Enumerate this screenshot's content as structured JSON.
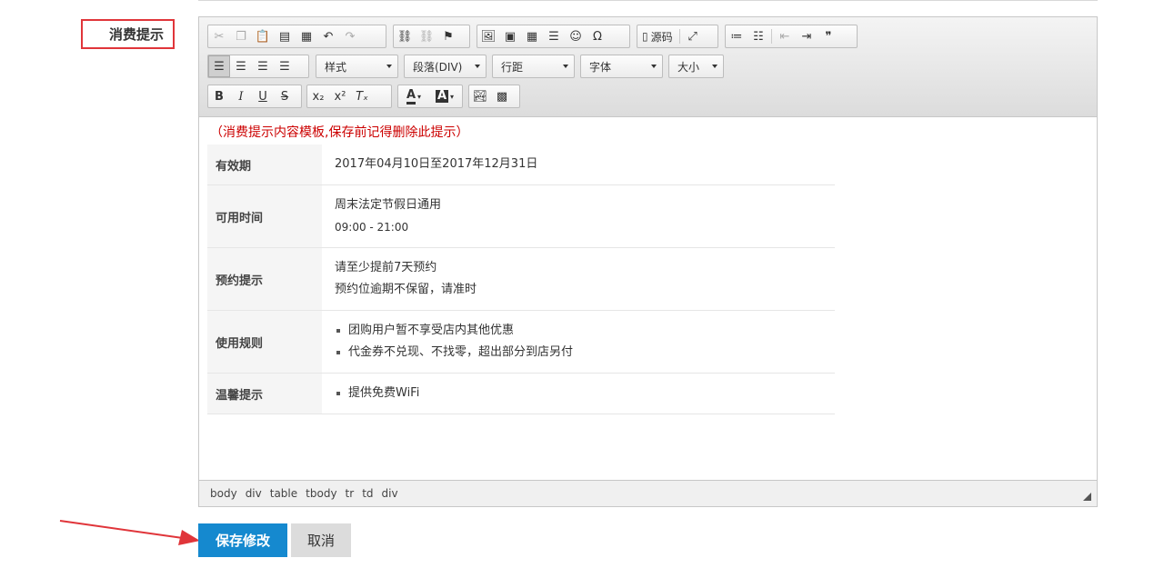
{
  "form": {
    "field_label": "消费提示",
    "save_label": "保存修改",
    "cancel_label": "取消"
  },
  "toolbar": {
    "source_label": "源码",
    "style_select": "样式",
    "paragraph_select": "段落(DIV)",
    "line_height_select": "行距",
    "font_select": "字体",
    "size_select": "大小",
    "omega": "Ω",
    "bold": "B",
    "italic": "I",
    "underline": "U",
    "strike": "S",
    "font_color": "A",
    "bg_color": "A",
    "quote": "❞"
  },
  "content": {
    "notice": "（消费提示内容模板,保存前记得删除此提示）",
    "rows": [
      {
        "key": "有效期",
        "lines": [
          "2017年04月10日至2017年12月31日"
        ]
      },
      {
        "key": "可用时间",
        "lines": [
          "周末法定节假日通用",
          "09:00 - 21:00"
        ]
      },
      {
        "key": "预约提示",
        "lines": [
          "请至少提前7天预约",
          "预约位逾期不保留，请准时"
        ]
      },
      {
        "key": "使用规则",
        "bullets": [
          "团购用户暂不享受店内其他优惠",
          "代金券不兑现、不找零，超出部分到店另付"
        ]
      },
      {
        "key": "温馨提示",
        "bullets": [
          "提供免费WiFi"
        ]
      }
    ]
  },
  "statusbar": {
    "path": [
      "body",
      "div",
      "table",
      "tbody",
      "tr",
      "td",
      "div"
    ]
  },
  "colors": {
    "accent": "#1589cf",
    "highlight_border": "#e0353a",
    "notice_text": "#cc0000"
  }
}
